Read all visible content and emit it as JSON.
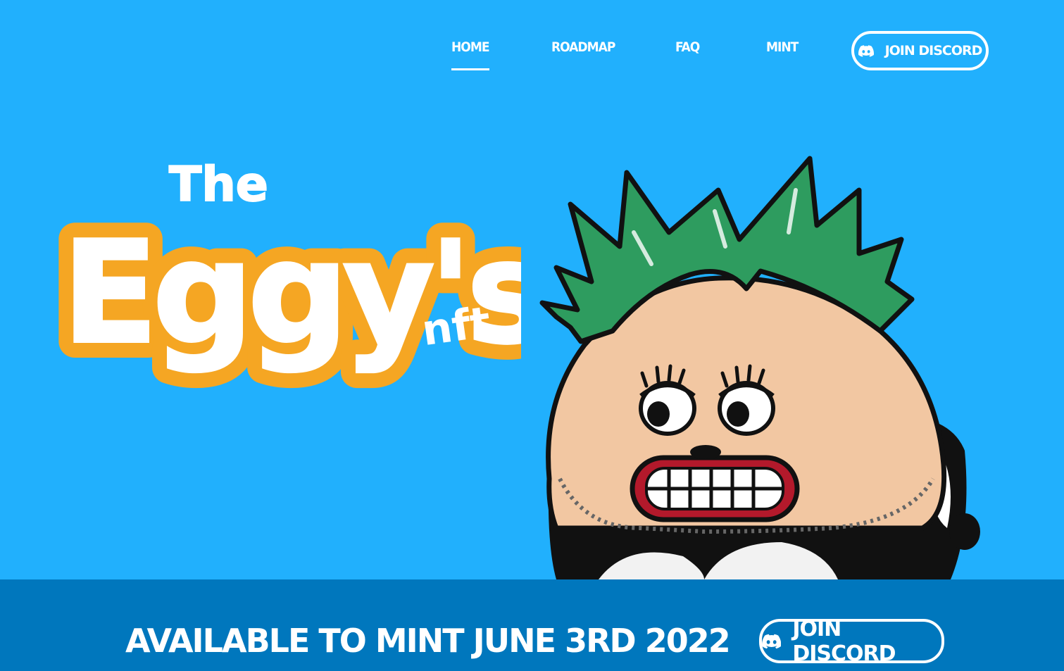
{
  "nav": {
    "items": [
      {
        "label": "HOME",
        "active": true
      },
      {
        "label": "ROADMAP",
        "active": false
      },
      {
        "label": "FAQ",
        "active": false
      },
      {
        "label": "MINT",
        "active": false
      }
    ],
    "discord_label": "JOIN DISCORD",
    "discord_icon": "discord-icon"
  },
  "logo": {
    "line1": "The",
    "line2": "Eggy's",
    "line3": "nft"
  },
  "banner": {
    "text": "AVAILABLE TO MINT JUNE 3RD 2022",
    "discord_label": "JOIN DISCORD",
    "discord_icon": "discord-icon"
  },
  "colors": {
    "background": "#21b0fd",
    "banner": "#0077bd",
    "logo_orange": "#f5a623",
    "hair_green": "#2e9c5f",
    "skin": "#f2c7a2"
  }
}
